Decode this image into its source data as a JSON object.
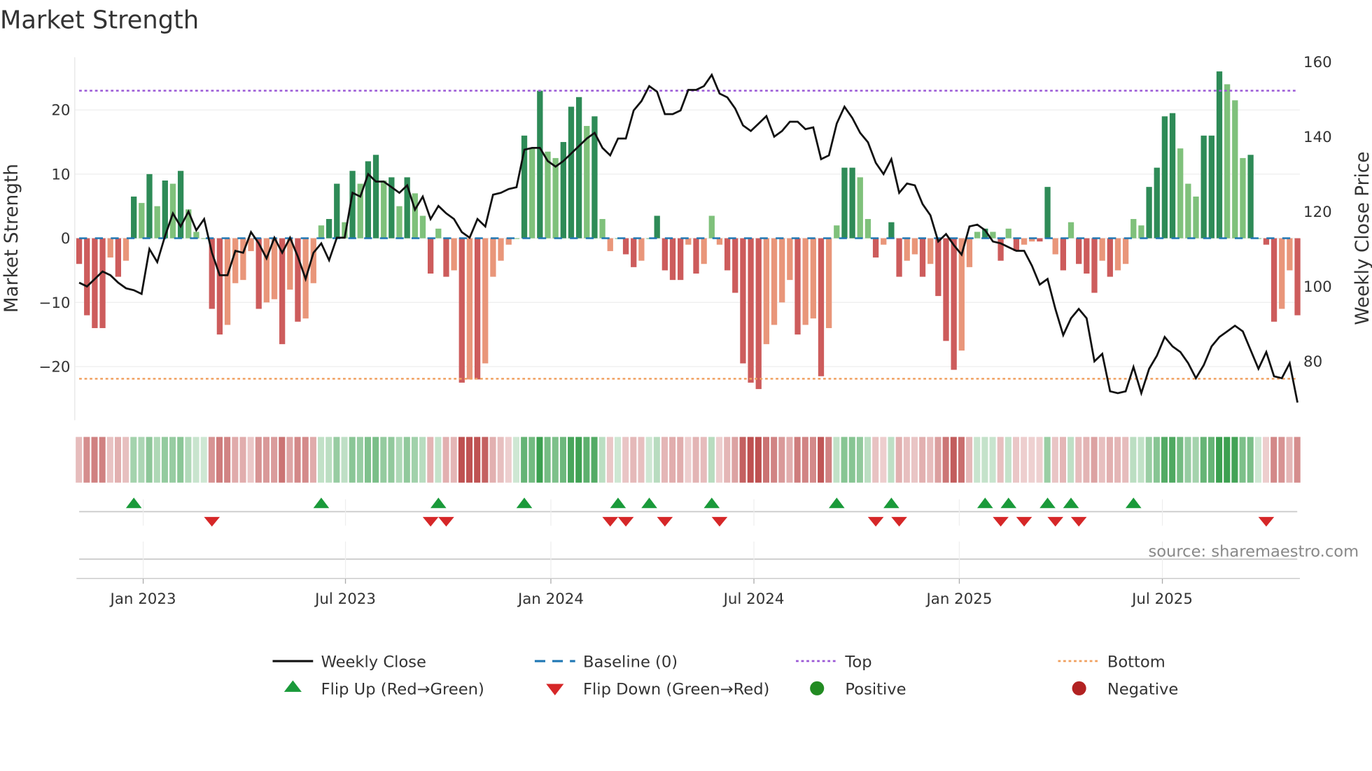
{
  "title": "Market Strength",
  "source": "source: sharemaestro.com",
  "chart_data": {
    "type": "bar",
    "title": "Market Strength",
    "ylabel": "Market Strength",
    "y2label": "Weekly Close Price",
    "ylim": [
      -28,
      28
    ],
    "y2lim": [
      66,
      164
    ],
    "y_ticks": [
      "20",
      "10",
      "0",
      "−10",
      "−20"
    ],
    "y_tick_values": [
      20,
      10,
      0,
      -10,
      -20
    ],
    "y2_ticks": [
      "160",
      "140",
      "120",
      "100",
      "80"
    ],
    "y2_tick_values": [
      160,
      140,
      120,
      100,
      80
    ],
    "x_ticks": [
      "Jan 2023",
      "Jul 2023",
      "Jan 2024",
      "Jul 2024",
      "Jan 2025",
      "Jul 2025"
    ],
    "x_tick_weeks": [
      8.2,
      34.1,
      60.4,
      86.4,
      112.7,
      138.7
    ],
    "top_level": 23,
    "bottom_level": -21.9,
    "baseline": 0,
    "strength": [
      -4,
      -12,
      -14,
      -14,
      -3,
      -6,
      -3.5,
      6.5,
      5.5,
      10,
      5,
      9,
      8.5,
      10.5,
      4.5,
      1,
      0,
      -11,
      -15,
      -13.5,
      -7,
      -6.5,
      -2,
      -11,
      -10,
      -9.5,
      -16.5,
      -8,
      -13,
      -12.5,
      -7,
      2,
      3,
      8.5,
      2.5,
      10.5,
      8.5,
      12,
      13,
      9,
      9.5,
      5,
      9.5,
      7,
      3.5,
      -5.5,
      1.5,
      -6,
      -5,
      -22.5,
      -22,
      -22,
      -19.5,
      -6,
      -3.5,
      -1,
      0,
      16,
      14,
      23,
      13.5,
      12.5,
      15,
      20.5,
      22,
      17.5,
      19,
      3,
      -2,
      0,
      -2.5,
      -4.5,
      -3.5,
      0,
      3.5,
      -5,
      -6.5,
      -6.5,
      -1,
      -5.5,
      -4,
      3.5,
      -1,
      -5,
      -8.5,
      -19.5,
      -22.5,
      -23.5,
      -16.5,
      -13.5,
      -10,
      -6.5,
      -15,
      -13.5,
      -12.5,
      -21.5,
      -14,
      2,
      11,
      11,
      9.5,
      3,
      -3,
      -1,
      2.5,
      -6,
      -3.5,
      -2.5,
      -6,
      -4,
      -9,
      -16,
      -20.5,
      -17.5,
      -4.5,
      1,
      1.5,
      1,
      -3.5,
      1.5,
      -2,
      -1,
      -0.5,
      -0.5,
      8,
      -2.5,
      -5,
      2.5,
      -4,
      -5.5,
      -8.5,
      -3.5,
      -6,
      -5,
      -4,
      3,
      2,
      8,
      11,
      19,
      19.5,
      14,
      8.5,
      6.5,
      16,
      16,
      26,
      24,
      21.5,
      12.5,
      13,
      0,
      -1,
      -13,
      -11,
      -5,
      -12
    ],
    "weekly_close": [
      101,
      100,
      102,
      104,
      103,
      101,
      99.5,
      99,
      98,
      110,
      106.5,
      113.5,
      119.5,
      116,
      120,
      115,
      118,
      109,
      103,
      103,
      109.5,
      109,
      114.5,
      111.5,
      107.5,
      113,
      109,
      113,
      108,
      102,
      109,
      111.5,
      107,
      113,
      113,
      125,
      124,
      130,
      128,
      128,
      126.5,
      125,
      127,
      120.5,
      124,
      118,
      121.5,
      119.5,
      118,
      114.5,
      113,
      118,
      116,
      124.5,
      125,
      126,
      126.5,
      136.5,
      137,
      137,
      133.5,
      132,
      133.5,
      135.5,
      137.5,
      139.5,
      141,
      137,
      135,
      139.5,
      139.5,
      147,
      149.5,
      153.5,
      152,
      146,
      146,
      147,
      152.5,
      152.5,
      153.5,
      156.5,
      151.5,
      150.5,
      147.5,
      143,
      141.5,
      143.5,
      145.5,
      140,
      141.5,
      144,
      144,
      142,
      142.5,
      134,
      135,
      143.5,
      148,
      145,
      141,
      138.5,
      133,
      130,
      134,
      125,
      127.5,
      127,
      122,
      119,
      112,
      114,
      111,
      108.5,
      116,
      116.5,
      115,
      112,
      111.5,
      110.5,
      109.5,
      109.5,
      105.5,
      100.5,
      102,
      94,
      87,
      91.5,
      94,
      91.5,
      80,
      82,
      72,
      71.5,
      72,
      78.5,
      71.5,
      78,
      81.5,
      86.5,
      84,
      82.5,
      79.5,
      75.5,
      79,
      84,
      86.5,
      88,
      89.5,
      88,
      83,
      78,
      82.5,
      76,
      75.5,
      79.5,
      69
    ],
    "flip_up_weeks": [
      7,
      31,
      46,
      57,
      69,
      73,
      81,
      97,
      104,
      116,
      119,
      124,
      127,
      135
    ],
    "flip_down_weeks": [
      17,
      45,
      47,
      68,
      70,
      75,
      82,
      102,
      105,
      118,
      121,
      125,
      128,
      152
    ],
    "legend": {
      "weekly_close": "Weekly Close",
      "baseline": "Baseline (0)",
      "top": "Top",
      "bottom": "Bottom",
      "flip_up": "Flip Up (Red→Green)",
      "flip_down": "Flip Down (Green→Red)",
      "positive": "Positive",
      "negative": "Negative"
    },
    "legend_position": "bottom-center",
    "colors": {
      "pos_strong": "#2e8b57",
      "pos_weak": "#7fc17b",
      "neg_strong": "#cd5c5c",
      "neg_weak": "#e9967a",
      "close": "#111111",
      "baseline": "#1f77b4",
      "top": "#9b59d6",
      "bottom": "#f0a060",
      "flip_up": "#1a9a3a",
      "flip_down": "#d62728",
      "positive": "#228b22",
      "negative": "#b22222"
    }
  }
}
